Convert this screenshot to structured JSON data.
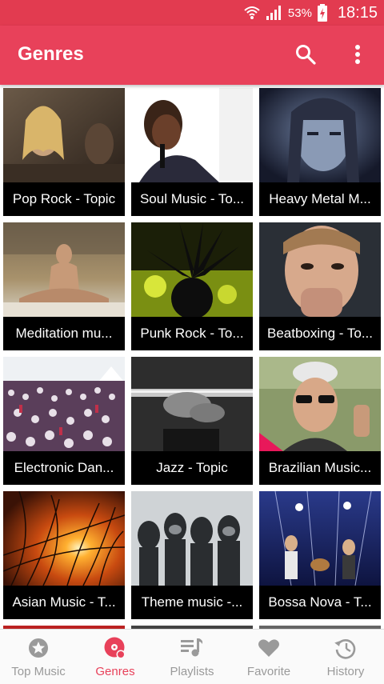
{
  "status_bar": {
    "battery": "53%",
    "time": "18:15",
    "icons": [
      "wifi-icon",
      "signal-icon",
      "battery-charging-icon"
    ]
  },
  "app_bar": {
    "title": "Genres",
    "actions": [
      "search-icon",
      "more-vert-icon"
    ],
    "color": "#e8415a"
  },
  "genres": [
    {
      "label": "Pop Rock - Topic"
    },
    {
      "label": "Soul Music - To..."
    },
    {
      "label": "Heavy Metal M..."
    },
    {
      "label": "Meditation mu..."
    },
    {
      "label": "Punk Rock - To..."
    },
    {
      "label": "Beatboxing - To..."
    },
    {
      "label": "Electronic Dan..."
    },
    {
      "label": "Jazz - Topic"
    },
    {
      "label": "Brazilian Music..."
    },
    {
      "label": "Asian Music - T..."
    },
    {
      "label": "Theme music -..."
    },
    {
      "label": "Bossa Nova - T..."
    }
  ],
  "bottom_nav": {
    "items": [
      {
        "label": "Top Music",
        "icon": "star-icon",
        "active": false
      },
      {
        "label": "Genres",
        "icon": "vinyl-record-icon",
        "active": true
      },
      {
        "label": "Playlists",
        "icon": "playlist-icon",
        "active": false
      },
      {
        "label": "Favorite",
        "icon": "heart-icon",
        "active": false
      },
      {
        "label": "History",
        "icon": "history-icon",
        "active": false
      }
    ],
    "active_color": "#e8415a",
    "inactive_color": "#9a9a9a"
  }
}
